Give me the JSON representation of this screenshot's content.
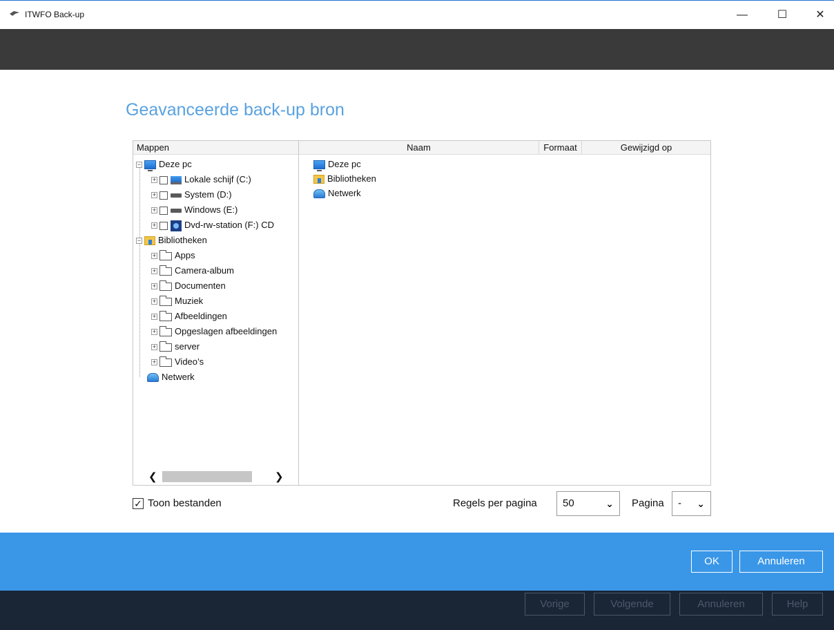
{
  "window": {
    "title": "ITWFO Back-up",
    "minimize": "—",
    "maximize": "☐",
    "close": "✕"
  },
  "dialog": {
    "heading": "Geavanceerde back-up bron"
  },
  "tree": {
    "header": "Mappen",
    "items": [
      {
        "label": "Deze pc"
      },
      {
        "label": "Lokale schijf (C:)"
      },
      {
        "label": "System (D:)"
      },
      {
        "label": "Windows (E:)"
      },
      {
        "label": "Dvd-rw-station (F:) CD"
      },
      {
        "label": "Bibliotheken"
      },
      {
        "label": "Apps"
      },
      {
        "label": "Camera-album"
      },
      {
        "label": "Documenten"
      },
      {
        "label": "Muziek"
      },
      {
        "label": "Afbeeldingen"
      },
      {
        "label": "Opgeslagen afbeeldingen"
      },
      {
        "label": "server"
      },
      {
        "label": "Video’s"
      },
      {
        "label": "Netwerk"
      }
    ]
  },
  "list": {
    "columns": {
      "name": "Naam",
      "size": "Formaat",
      "modified": "Gewijzigd op"
    },
    "rows": [
      {
        "name": "Deze pc"
      },
      {
        "name": "Bibliotheken"
      },
      {
        "name": "Netwerk"
      }
    ]
  },
  "options": {
    "show_files": "Toon bestanden",
    "rows_per_page_label": "Regels per pagina",
    "rows_per_page_value": "50",
    "page_label": "Pagina",
    "page_value": "-"
  },
  "buttons": {
    "ok": "OK",
    "cancel": "Annuleren"
  },
  "footer": {
    "prev": "Vorige",
    "next": "Volgende",
    "cancel": "Annuleren",
    "help": "Help"
  },
  "colors": {
    "accent": "#3a97e8",
    "heading": "#5aa2e0",
    "dark": "#3a3a3a",
    "footer": "#1a2535"
  }
}
